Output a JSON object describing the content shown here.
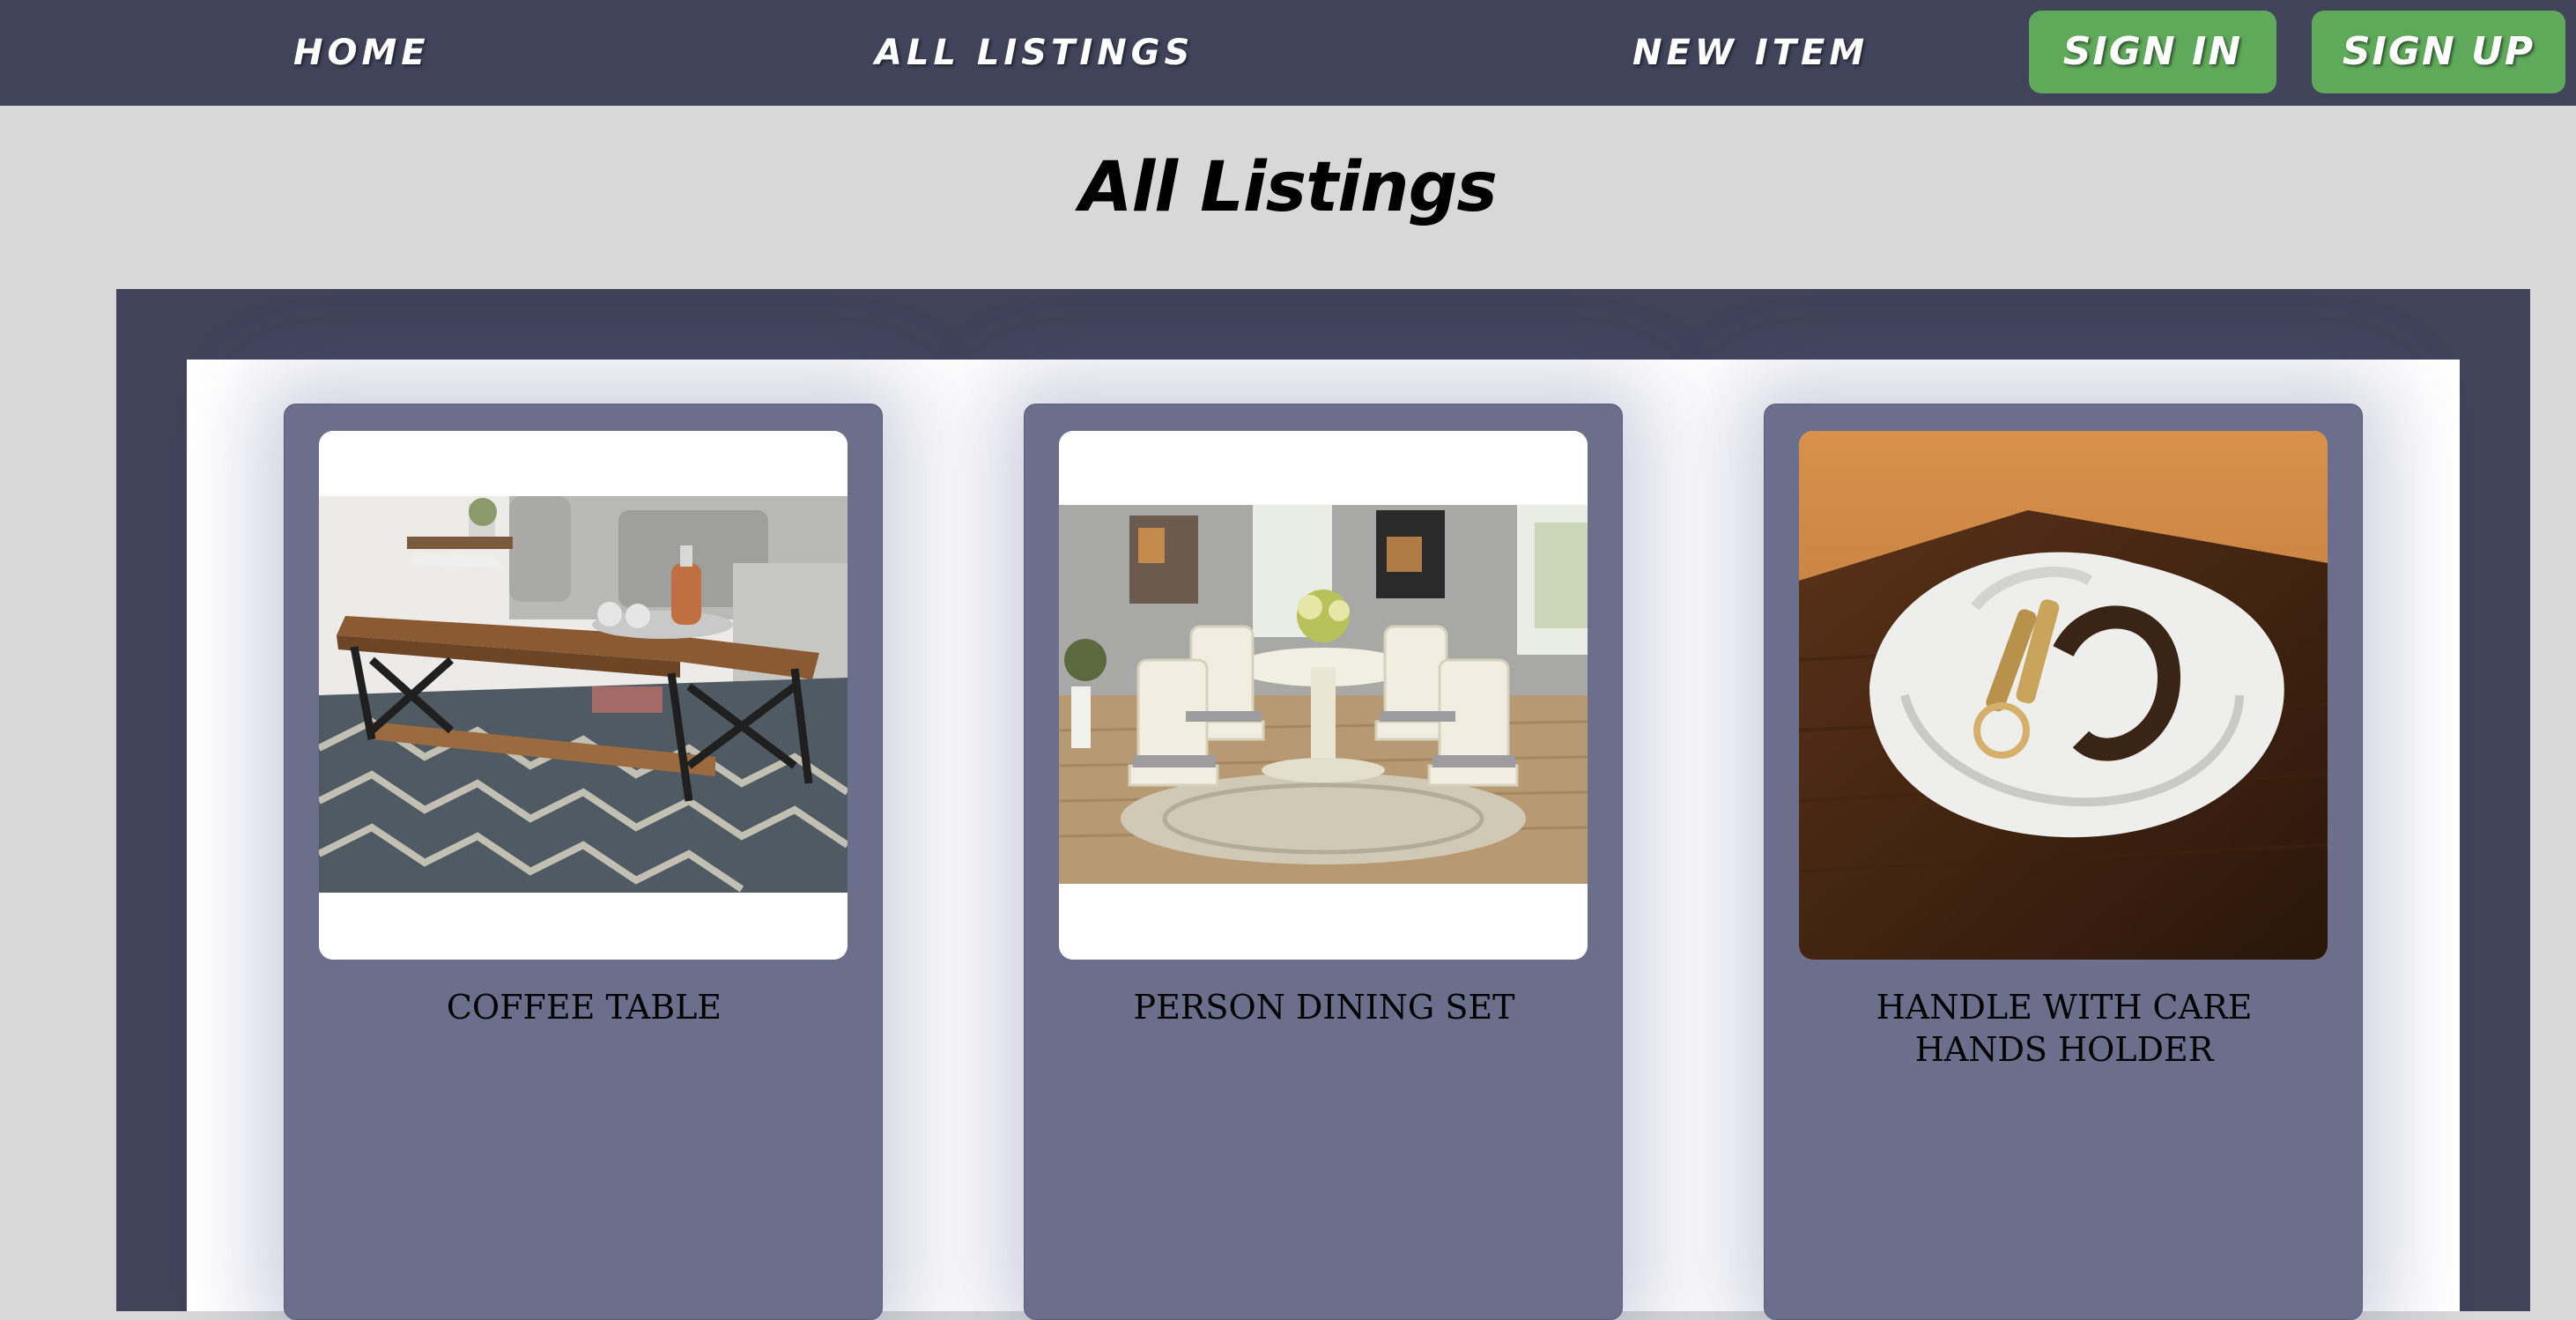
{
  "nav": {
    "home": "HOME",
    "all_listings": "ALL LISTINGS",
    "new_item": "NEW ITEM",
    "sign_in": "SIGN IN",
    "sign_up": "SIGN UP"
  },
  "page": {
    "title": "All Listings"
  },
  "listings": [
    {
      "title_lines": [
        "COFFEE TABLE"
      ],
      "image": "coffee-table-photo"
    },
    {
      "title_lines": [
        "PERSON DINING SET"
      ],
      "image": "dining-set-photo"
    },
    {
      "title_lines": [
        "HANDLE WITH CARE",
        "HANDS HOLDER"
      ],
      "image": "hands-holder-photo"
    }
  ],
  "colors": {
    "navbar": "#40435a",
    "accent_button": "#5fa95b",
    "page_background": "#d8d8d8",
    "card": "#6b6f8c"
  }
}
